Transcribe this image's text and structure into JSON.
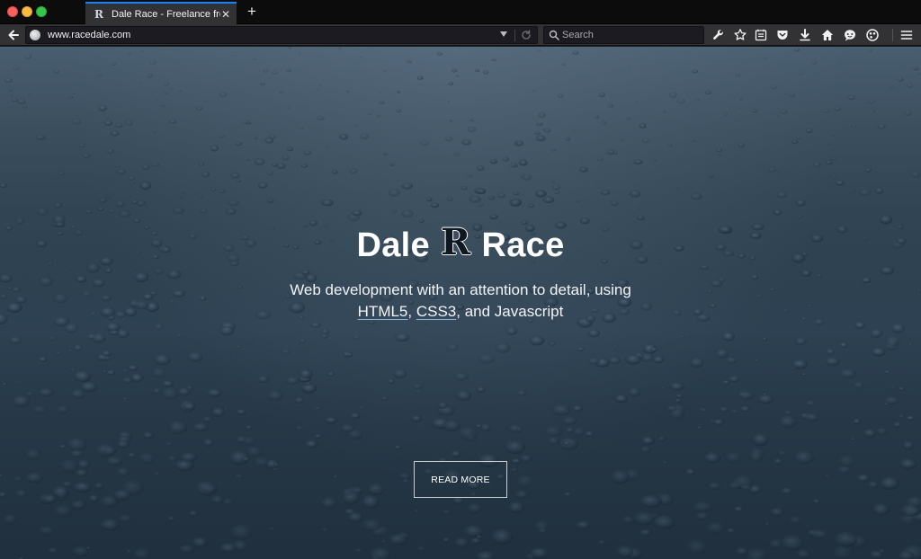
{
  "browser": {
    "tab": {
      "title": "Dale Race - Freelance front...",
      "favicon": "R",
      "close_label": "✕"
    },
    "new_tab_label": "+",
    "url": "www.racedale.com",
    "search": {
      "placeholder": "Search",
      "value": ""
    },
    "toolbar_icons": [
      "wrench-icon",
      "bookmark-star-icon",
      "reading-list-icon",
      "pocket-icon",
      "download-icon",
      "home-icon",
      "chat-icon",
      "extension-icon",
      "menu-icon"
    ],
    "accent_color": "#0a84ff"
  },
  "hero": {
    "title_first": "Dale",
    "logo_mark": "R",
    "title_last": "Race",
    "subtitle_line1": "Web development with an attention to detail, using",
    "link_html5": "HTML5",
    "comma": ", ",
    "link_css3": "CSS3",
    "subtitle_rest": ", and Javascript",
    "button_label": "READ MORE",
    "background_color": "#2c4051"
  }
}
